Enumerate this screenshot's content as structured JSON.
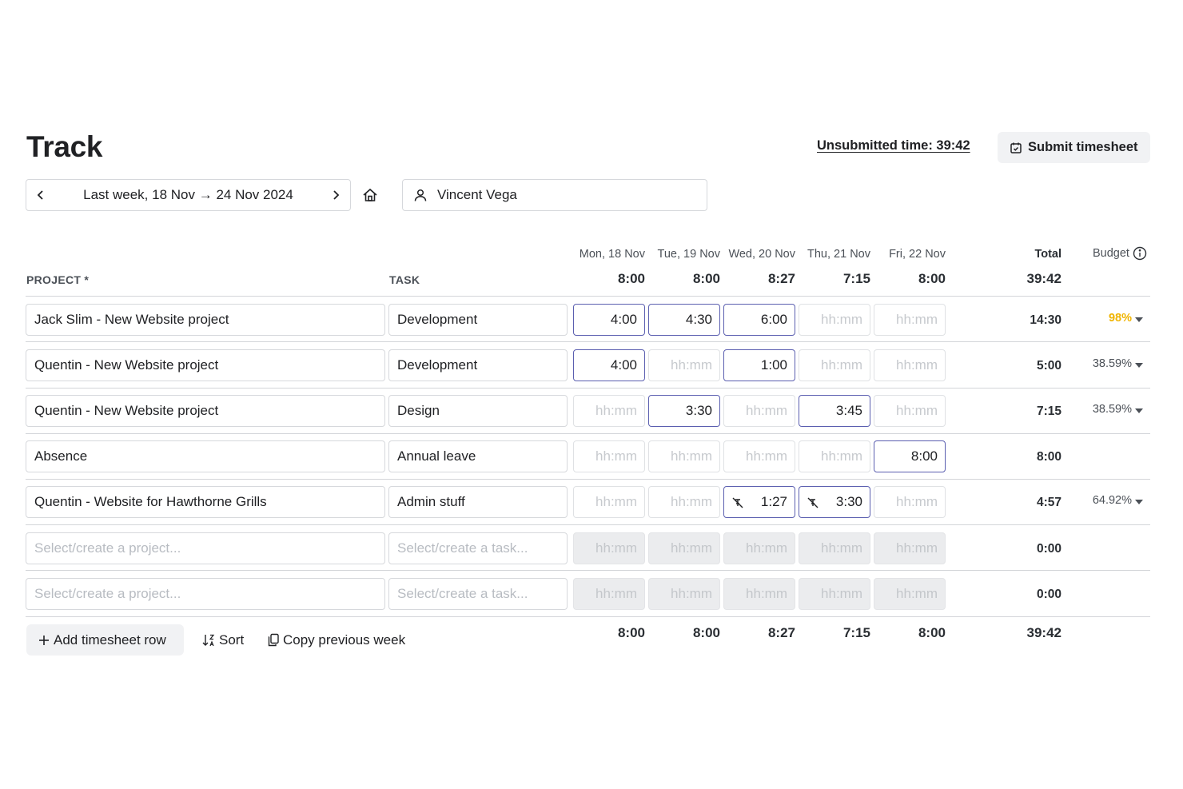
{
  "page": {
    "title": "Track"
  },
  "header": {
    "unsubmitted_time": "Unsubmitted time: 39:42",
    "submit_label": "Submit timesheet"
  },
  "week_nav": {
    "label": "Last week, 18 Nov → 24 Nov 2024"
  },
  "user_select": {
    "value": "Vincent Vega"
  },
  "columns": {
    "project": "PROJECT *",
    "task": "TASK",
    "total": "Total",
    "budget": "Budget",
    "days": [
      {
        "label": "Mon, 18 Nov",
        "total": "8:00"
      },
      {
        "label": "Tue, 19 Nov",
        "total": "8:00"
      },
      {
        "label": "Wed, 20 Nov",
        "total": "8:27"
      },
      {
        "label": "Thu, 21 Nov",
        "total": "7:15"
      },
      {
        "label": "Fri, 22 Nov",
        "total": "8:00"
      }
    ],
    "grand_total": "39:42"
  },
  "time_placeholder": "hh:mm",
  "rows": [
    {
      "project": "Jack Slim - New Website project",
      "task": "Development",
      "times": [
        "4:00",
        "4:30",
        "6:00",
        "",
        ""
      ],
      "total": "14:30",
      "budget": "98%"
    },
    {
      "project": "Quentin - New Website project",
      "task": "Development",
      "times": [
        "4:00",
        "",
        "1:00",
        "",
        ""
      ],
      "total": "5:00",
      "budget": "38.59%"
    },
    {
      "project": "Quentin - New Website project",
      "task": "Design",
      "times": [
        "",
        "3:30",
        "",
        "3:45",
        ""
      ],
      "total": "7:15",
      "budget": "38.59%"
    },
    {
      "project": "Absence",
      "task": "Annual leave",
      "times": [
        "",
        "",
        "",
        "",
        "8:00"
      ],
      "total": "8:00",
      "budget": ""
    },
    {
      "project": "Quentin - Website for Hawthorne Grills",
      "task": "Admin stuff",
      "times": [
        "",
        "",
        "1:27",
        "3:30",
        ""
      ],
      "total": "4:57",
      "budget": "64.92%"
    },
    {
      "project": "",
      "task": "",
      "times": [
        "",
        "",
        "",
        "",
        ""
      ],
      "total": "0:00",
      "budget": ""
    },
    {
      "project": "",
      "task": "",
      "times": [
        "",
        "",
        "",
        "",
        ""
      ],
      "total": "0:00",
      "budget": ""
    }
  ],
  "empty_row": {
    "project_placeholder": "Select/create a project...",
    "task_placeholder": "Select/create a task..."
  },
  "footer": {
    "add_row": "Add timesheet row",
    "sort": "Sort",
    "copy_week": "Copy previous week"
  },
  "colors": {
    "accent_border": "#5b5fb0",
    "budget_warning": "#f0b400"
  },
  "icons": [
    "chevron-left-icon",
    "chevron-right-icon",
    "home-icon",
    "user-icon",
    "calendar-check-icon",
    "info-icon",
    "plus-icon",
    "sort-icon",
    "copy-icon",
    "non-billable-icon",
    "caret-down-icon"
  ]
}
